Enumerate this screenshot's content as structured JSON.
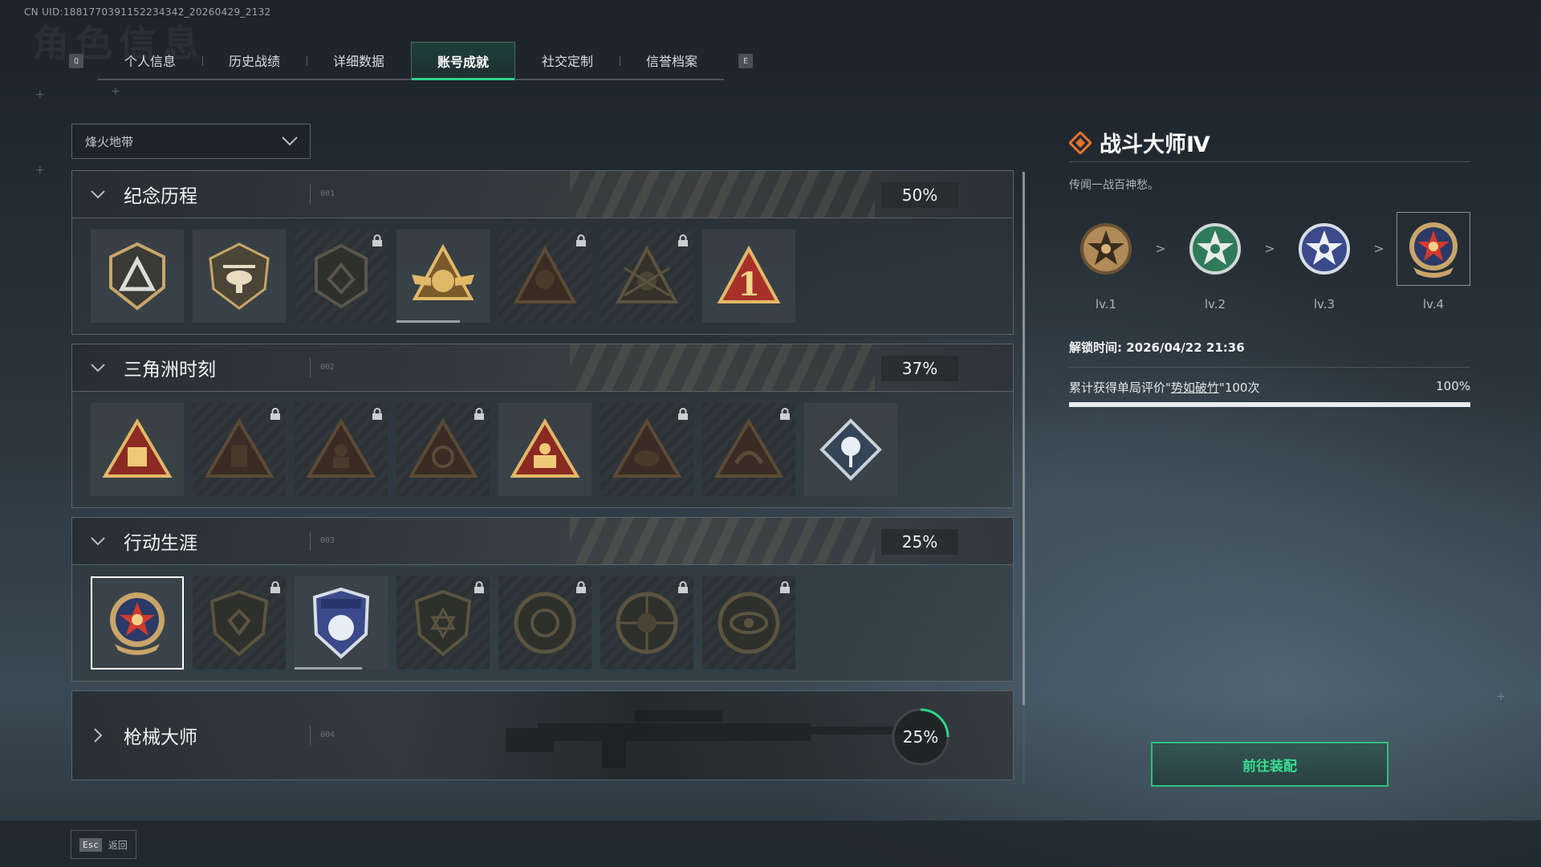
{
  "header": {
    "uid": "CN UID:1881770391152234342_20260429_2132",
    "ghost_title": "角色信息"
  },
  "tabs": {
    "prev_key": "Q",
    "next_key": "E",
    "items": [
      {
        "label": "个人信息"
      },
      {
        "label": "历史战绩"
      },
      {
        "label": "详细数据"
      },
      {
        "label": "账号成就",
        "active": true
      },
      {
        "label": "社交定制"
      },
      {
        "label": "信誉档案"
      }
    ]
  },
  "filter": {
    "selected": "烽火地带"
  },
  "sections": [
    {
      "title": "纪念历程",
      "num": "001",
      "percent": "50%",
      "expanded": true
    },
    {
      "title": "三角洲时刻",
      "num": "002",
      "percent": "37%",
      "expanded": true
    },
    {
      "title": "行动生涯",
      "num": "003",
      "percent": "25%",
      "expanded": true
    },
    {
      "title": "枪械大师",
      "num": "004",
      "percent": "25%",
      "expanded": false,
      "progress": 0.25
    }
  ],
  "achievement": {
    "title": "战斗大师Ⅳ",
    "description": "传闻一战百神愁。",
    "levels": [
      {
        "label": "lv.1"
      },
      {
        "label": "lv.2"
      },
      {
        "label": "lv.3"
      },
      {
        "label": "lv.4"
      }
    ],
    "unlock_time": "解锁时间: 2026/04/22 21:36",
    "condition_prefix": "累计获得单局评价\"",
    "condition_link": "势如破竹",
    "condition_suffix": "\"100次",
    "condition_percent": "100%",
    "condition_progress": 1.0,
    "equip_label": "前往装配"
  },
  "footer": {
    "esc_key": "Esc",
    "esc_label": "返回"
  },
  "colors": {
    "accent": "#2fd28a",
    "panel_border": "#5b6469",
    "gold": "#c9a56a"
  }
}
